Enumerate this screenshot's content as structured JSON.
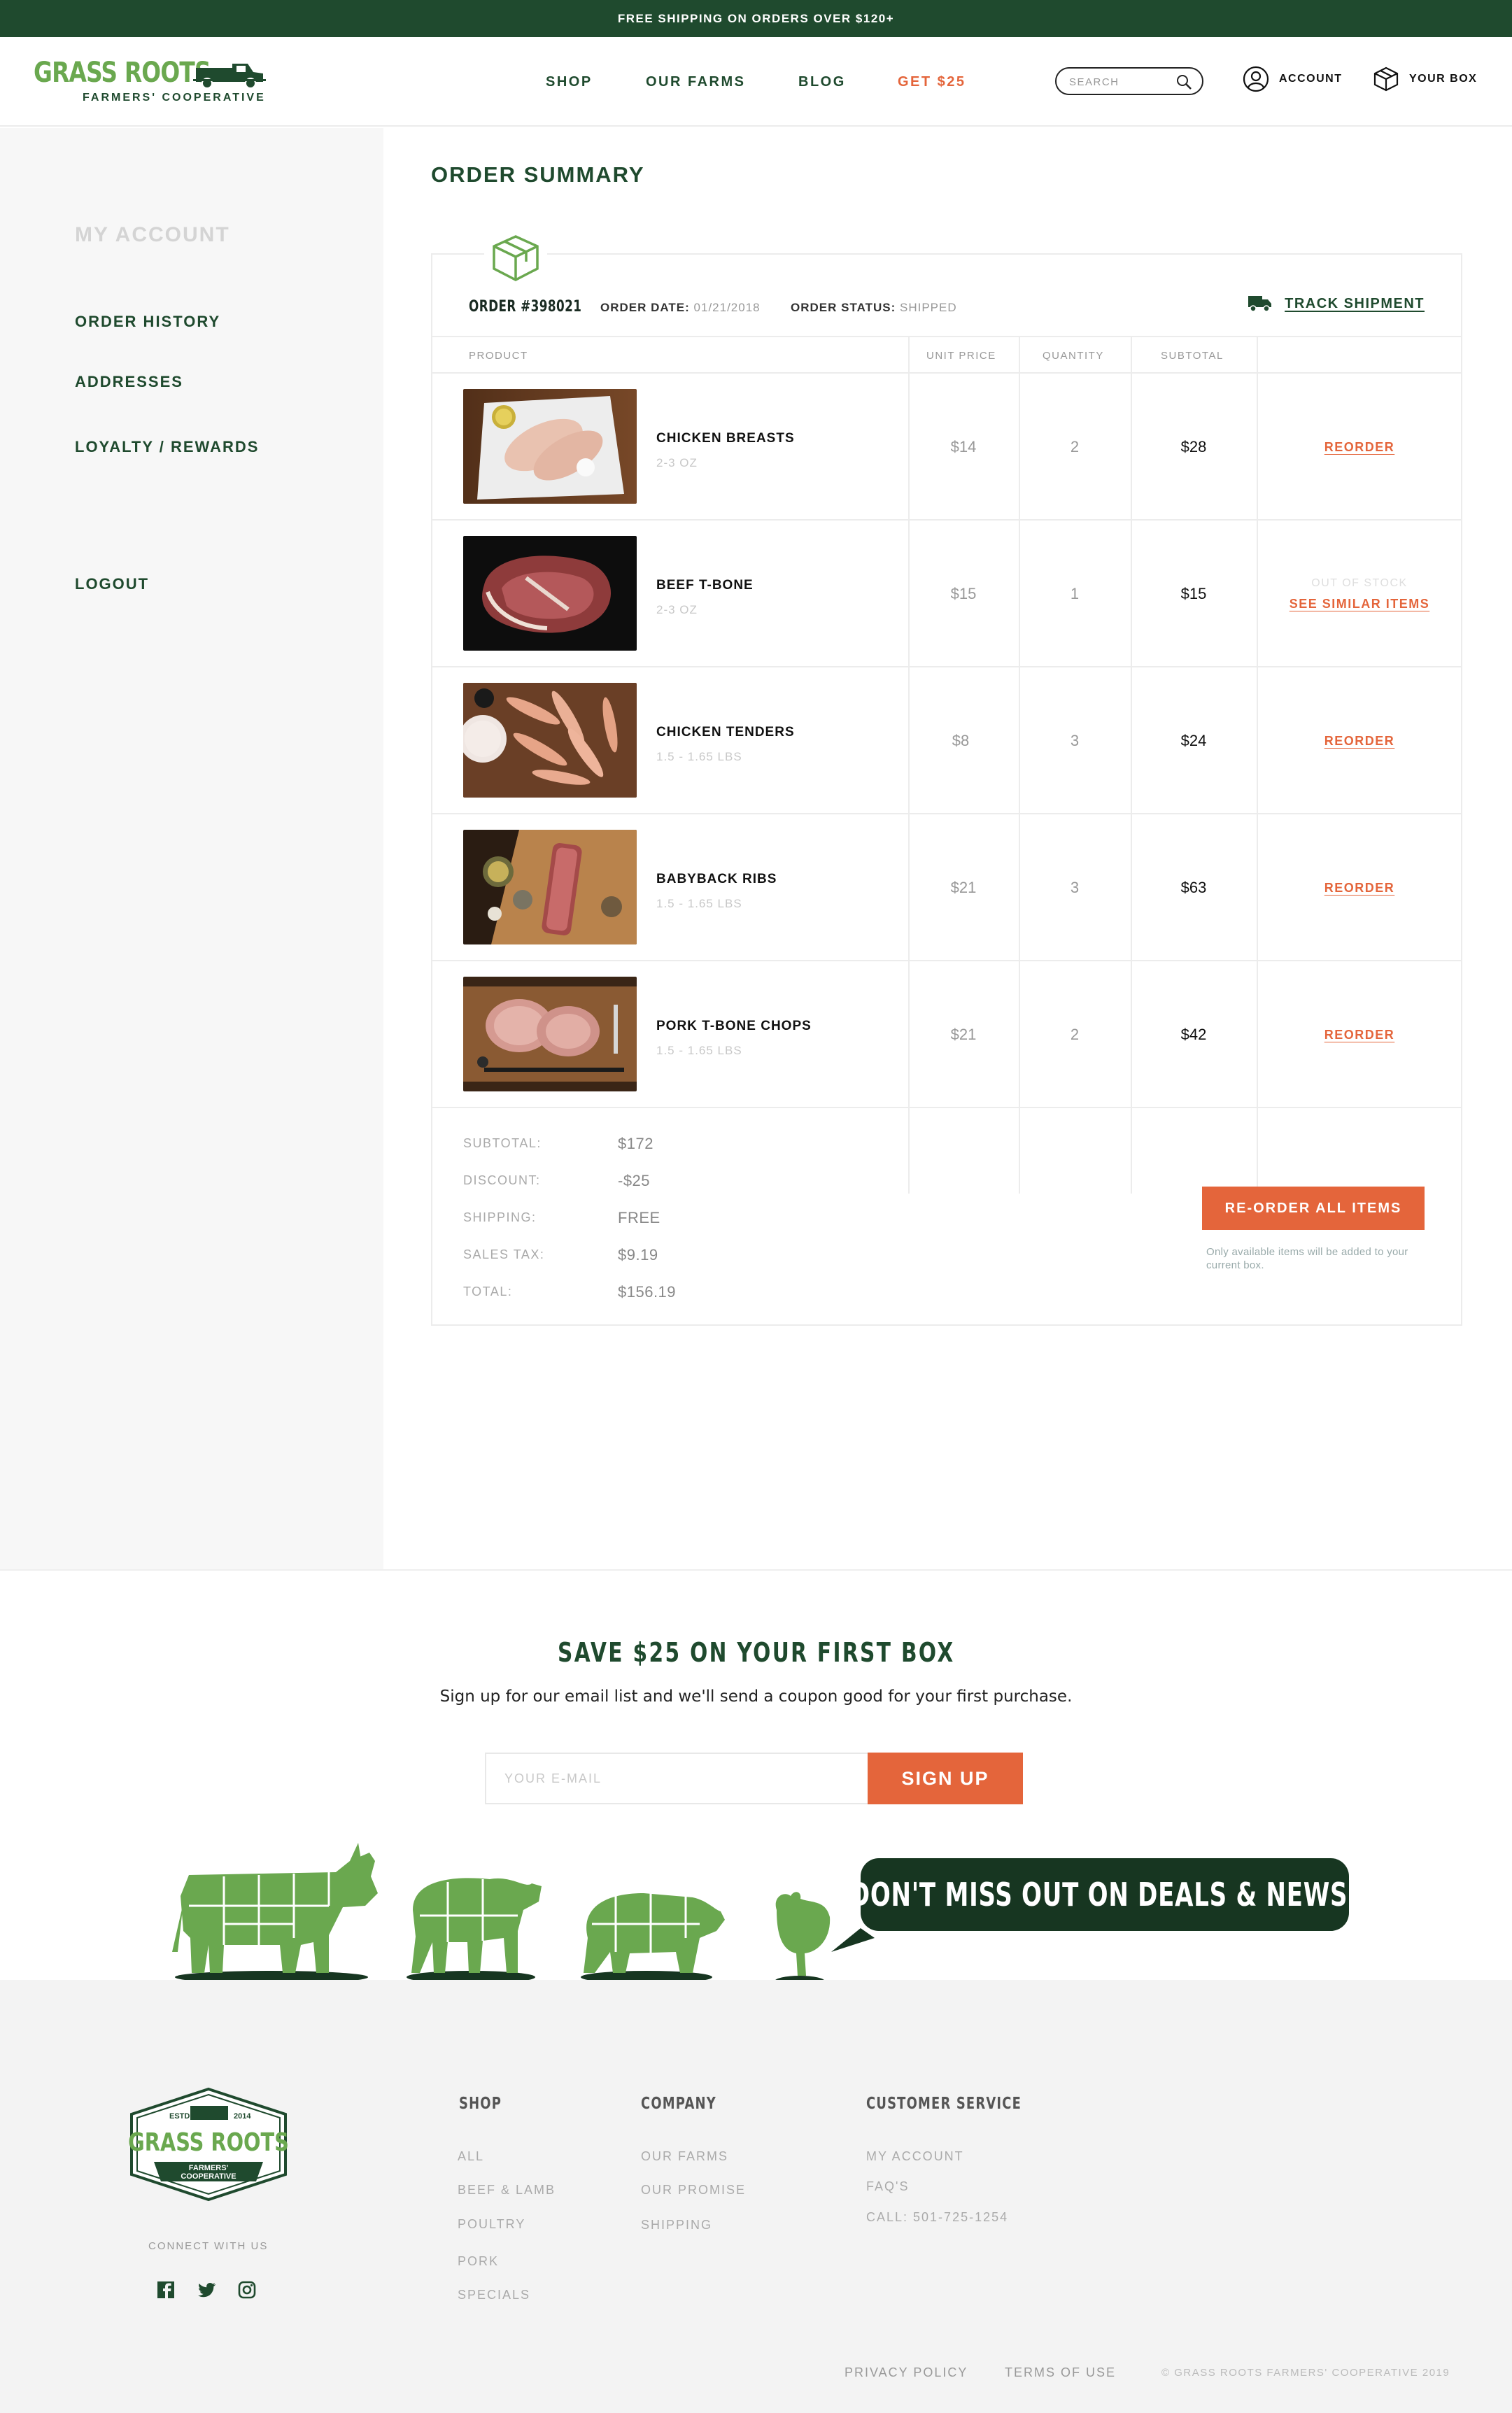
{
  "promo_bar": "FREE SHIPPING ON ORDERS OVER $120+",
  "brand": {
    "title": "GRASS ROOTS",
    "subtitle": "FARMERS' COOPERATIVE"
  },
  "nav": [
    "SHOP",
    "OUR FARMS",
    "BLOG",
    "GET $25"
  ],
  "search": {
    "placeholder": "SEARCH"
  },
  "header_links": {
    "account": "ACCOUNT",
    "box": "YOUR BOX"
  },
  "sidebar": {
    "title": "MY ACCOUNT",
    "items": [
      "ORDER HISTORY",
      "ADDRESSES",
      "LOYALTY / REWARDS"
    ],
    "logout": "LOGOUT"
  },
  "page_title": "ORDER SUMMARY",
  "order": {
    "number": "ORDER #398021",
    "date_label": "ORDER DATE:",
    "date": "01/21/2018",
    "status_label": "ORDER STATUS:",
    "status": "SHIPPED",
    "track_label": "TRACK SHIPMENT",
    "columns": [
      "PRODUCT",
      "UNIT PRICE",
      "QUANTITY",
      "SUBTOTAL"
    ],
    "items": [
      {
        "name": "CHICKEN BREASTS",
        "weight": "2-3 OZ",
        "price": "$14",
        "qty": "2",
        "subtotal": "$28",
        "action": "REORDER",
        "out_of_stock": ""
      },
      {
        "name": "BEEF T-BONE",
        "weight": "2-3 OZ",
        "price": "$15",
        "qty": "1",
        "subtotal": "$15",
        "action": "SEE SIMILAR ITEMS",
        "out_of_stock": "OUT OF STOCK"
      },
      {
        "name": "CHICKEN TENDERS",
        "weight": "1.5 - 1.65 LBS",
        "price": "$8",
        "qty": "3",
        "subtotal": "$24",
        "action": "REORDER",
        "out_of_stock": ""
      },
      {
        "name": "BABYBACK RIBS",
        "weight": "1.5 - 1.65 LBS",
        "price": "$21",
        "qty": "3",
        "subtotal": "$63",
        "action": "REORDER",
        "out_of_stock": ""
      },
      {
        "name": "PORK T-BONE CHOPS",
        "weight": "1.5 - 1.65 LBS",
        "price": "$21",
        "qty": "2",
        "subtotal": "$42",
        "action": "REORDER",
        "out_of_stock": ""
      }
    ],
    "totals": [
      {
        "label": "SUBTOTAL:",
        "value": "$172"
      },
      {
        "label": "DISCOUNT:",
        "value": "-$25"
      },
      {
        "label": "SHIPPING:",
        "value": "FREE"
      },
      {
        "label": "SALES TAX:",
        "value": "$9.19"
      },
      {
        "label": "TOTAL:",
        "value": "$156.19"
      }
    ],
    "reorder_all": "RE-ORDER ALL ITEMS",
    "reorder_note": "Only available items will be added to your current box."
  },
  "newsletter": {
    "title": "SAVE $25 ON YOUR FIRST BOX",
    "subtitle": "Sign up for our email list and we'll send a coupon good for your first purchase.",
    "email_placeholder": "YOUR E-MAIL",
    "button": "SIGN UP",
    "bubble": "DON'T MISS OUT ON DEALS & NEWS!"
  },
  "footer": {
    "badge": {
      "estd": "ESTD.",
      "year": "2014",
      "title": "GRASS ROOTS",
      "line1": "FARMERS'",
      "line2": "COOPERATIVE"
    },
    "connect": "CONNECT WITH US",
    "columns": [
      {
        "title": "SHOP",
        "links": [
          "ALL",
          "BEEF & LAMB",
          "POULTRY",
          "PORK",
          "SPECIALS"
        ]
      },
      {
        "title": "COMPANY",
        "links": [
          "OUR FARMS",
          "OUR PROMISE",
          "SHIPPING"
        ]
      },
      {
        "title": "CUSTOMER SERVICE",
        "links": [
          "MY ACCOUNT",
          "FAQ'S",
          "CALL: 501-725-1254"
        ]
      }
    ],
    "legal": [
      "PRIVACY POLICY",
      "TERMS OF USE"
    ],
    "copyright": "© GRASS ROOTS FARMERS' COOPERATIVE 2019"
  },
  "colors": {
    "brand_green": "#1f4a2e",
    "leaf_green": "#6aa84f",
    "accent_orange": "#e4653b"
  }
}
